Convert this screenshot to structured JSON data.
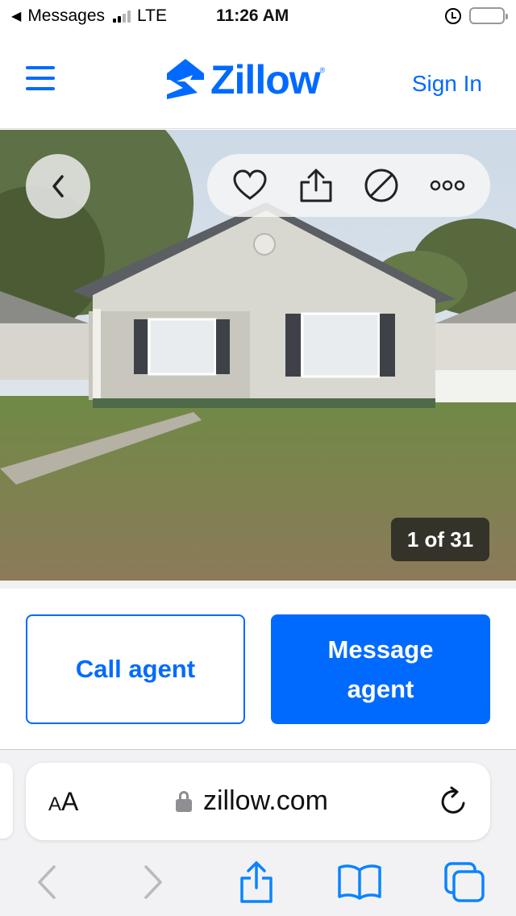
{
  "status_bar": {
    "back_app": "Messages",
    "network": "LTE",
    "time": "11:26 AM",
    "signal_bars": 2,
    "battery_level": 0.15
  },
  "header": {
    "brand": "Zillow",
    "sign_in_label": "Sign In",
    "menu_icon": "hamburger-menu-icon",
    "brand_color": "#006aff"
  },
  "photo": {
    "back_icon": "chevron-left-icon",
    "actions": [
      {
        "icon": "heart-icon",
        "label": "Save"
      },
      {
        "icon": "share-icon",
        "label": "Share"
      },
      {
        "icon": "hide-icon",
        "label": "Hide"
      },
      {
        "icon": "more-icon",
        "label": "More"
      }
    ],
    "counter": "1 of 31"
  },
  "cta": {
    "call_label": "Call agent",
    "message_label": "Message agent"
  },
  "browser": {
    "text_size_small": "A",
    "text_size_big": "A",
    "domain": "zillow.com",
    "toolbar_icons": [
      "back-icon",
      "forward-icon",
      "share-icon",
      "bookmarks-icon",
      "tabs-icon"
    ]
  }
}
